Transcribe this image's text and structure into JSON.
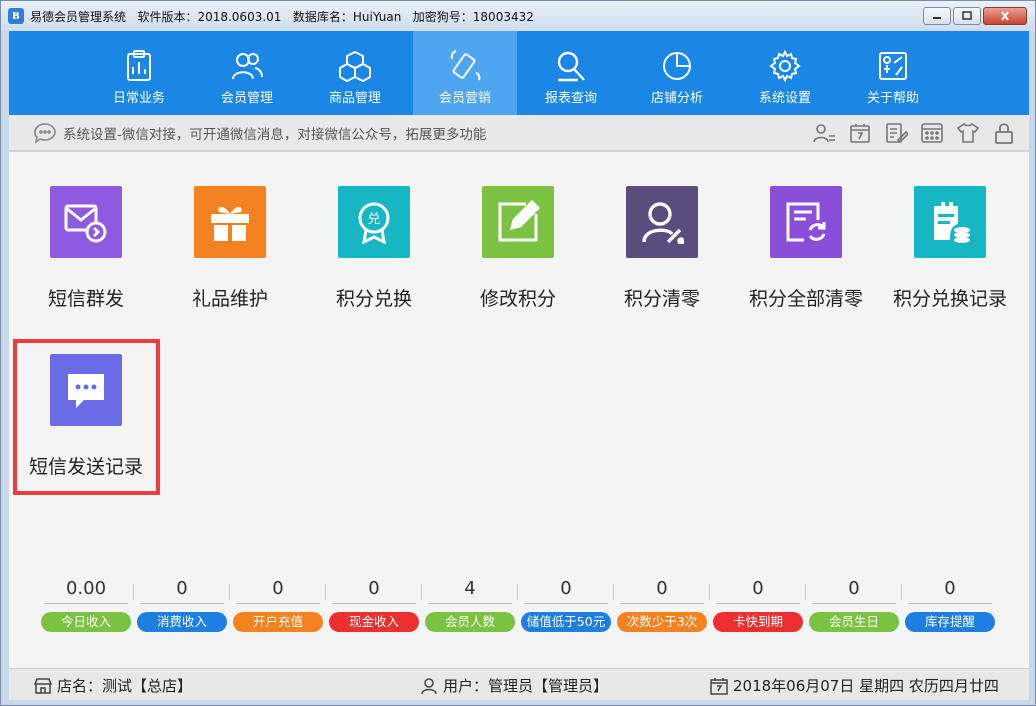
{
  "window": {
    "logo": "B",
    "title": "易德会员管理系统   软件版本：2018.0603.01   数据库名：HuiYuan   加密狗号：18003432"
  },
  "nav": [
    {
      "label": "日常业务",
      "icon": "clipboard-icon"
    },
    {
      "label": "会员管理",
      "icon": "users-icon"
    },
    {
      "label": "商品管理",
      "icon": "boxes-icon"
    },
    {
      "label": "会员营销",
      "icon": "phone-icon",
      "active": true
    },
    {
      "label": "报表查询",
      "icon": "search-report-icon"
    },
    {
      "label": "店铺分析",
      "icon": "pie-chart-icon"
    },
    {
      "label": "系统设置",
      "icon": "gear-icon"
    },
    {
      "label": "关于帮助",
      "icon": "help-icon"
    }
  ],
  "notice": {
    "text": "系统设置-微信对接，可开通微信消息，对接微信公众号，拓展更多功能"
  },
  "tiles": [
    {
      "label": "短信群发",
      "color": "#8e5ae0",
      "icon": "mail-send-icon"
    },
    {
      "label": "礼品维护",
      "color": "#f58220",
      "icon": "gift-icon"
    },
    {
      "label": "积分兑换",
      "color": "#16b6c2",
      "icon": "badge-exchange-icon"
    },
    {
      "label": "修改积分",
      "color": "#7cc242",
      "icon": "edit-icon"
    },
    {
      "label": "积分清零",
      "color": "#5a4d7e",
      "icon": "user-clear-icon"
    },
    {
      "label": "积分全部清零",
      "color": "#8a4fd8",
      "icon": "doc-refresh-icon"
    },
    {
      "label": "积分兑换记录",
      "color": "#16b6c2",
      "icon": "records-icon"
    },
    {
      "label": "短信发送记录",
      "color": "#6c6be6",
      "icon": "chat-bubble-icon"
    }
  ],
  "stats": [
    {
      "value": "0.00",
      "label": "今日收入",
      "color": "#7cc242"
    },
    {
      "value": "0",
      "label": "消费收入",
      "color": "#1e7fe0"
    },
    {
      "value": "0",
      "label": "开户充值",
      "color": "#f58220"
    },
    {
      "value": "0",
      "label": "现金收入",
      "color": "#ee2f2f"
    },
    {
      "value": "4",
      "label": "会员人数",
      "color": "#7cc242"
    },
    {
      "value": "0",
      "label": "储值低于50元",
      "color": "#1e7fe0"
    },
    {
      "value": "0",
      "label": "次数少于3次",
      "color": "#f58220"
    },
    {
      "value": "0",
      "label": "卡快到期",
      "color": "#ee2f2f"
    },
    {
      "value": "0",
      "label": "会员生日",
      "color": "#7cc242"
    },
    {
      "value": "0",
      "label": "库存提醒",
      "color": "#1e7fe0"
    }
  ],
  "status": {
    "store": "店名：测试【总店】",
    "user": "用户：管理员【管理员】",
    "date": "2018年06月07日 星期四 农历四月廿四"
  }
}
